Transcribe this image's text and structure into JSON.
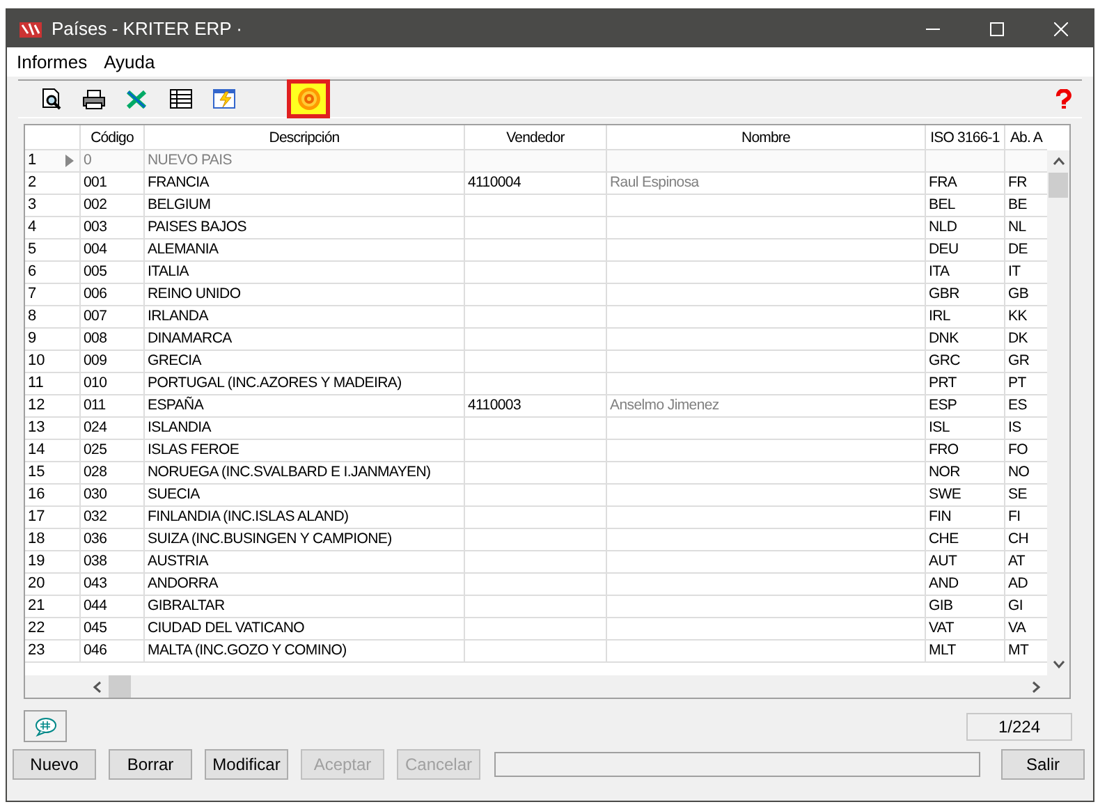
{
  "window": {
    "title": "Países - KRITER ERP ·"
  },
  "menu": [
    "Informes",
    "Ayuda"
  ],
  "toolbar": [
    {
      "kind": "preview",
      "selected": false
    },
    {
      "kind": "print",
      "selected": false
    },
    {
      "kind": "excel",
      "selected": false
    },
    {
      "kind": "grid",
      "selected": false
    },
    {
      "kind": "grid-edit",
      "selected": false
    },
    {
      "kind": "target",
      "selected": true
    }
  ],
  "table": {
    "columns": [
      "",
      "Código",
      "Descripción",
      "Vendedor",
      "Nombre",
      "ISO 3166-1",
      "Ab. A"
    ],
    "rows": [
      {
        "current": true,
        "cells": [
          "1",
          "0",
          "NUEVO PAIS",
          "",
          "",
          "",
          ""
        ]
      },
      {
        "current": false,
        "cells": [
          "2",
          "001",
          "FRANCIA",
          "4110004",
          "Raul Espinosa",
          "FRA",
          "FR"
        ]
      },
      {
        "current": false,
        "cells": [
          "3",
          "002",
          "BELGIUM",
          "",
          "",
          "BEL",
          "BE"
        ]
      },
      {
        "current": false,
        "cells": [
          "4",
          "003",
          "PAISES BAJOS",
          "",
          "",
          "NLD",
          "NL"
        ]
      },
      {
        "current": false,
        "cells": [
          "5",
          "004",
          "ALEMANIA",
          "",
          "",
          "DEU",
          "DE"
        ]
      },
      {
        "current": false,
        "cells": [
          "6",
          "005",
          "ITALIA",
          "",
          "",
          "ITA",
          "IT"
        ]
      },
      {
        "current": false,
        "cells": [
          "7",
          "006",
          "REINO UNIDO",
          "",
          "",
          "GBR",
          "GB"
        ]
      },
      {
        "current": false,
        "cells": [
          "8",
          "007",
          "IRLANDA",
          "",
          "",
          "IRL",
          "KK"
        ]
      },
      {
        "current": false,
        "cells": [
          "9",
          "008",
          "DINAMARCA",
          "",
          "",
          "DNK",
          "DK"
        ]
      },
      {
        "current": false,
        "cells": [
          "10",
          "009",
          "GRECIA",
          "",
          "",
          "GRC",
          "GR"
        ]
      },
      {
        "current": false,
        "cells": [
          "11",
          "010",
          "PORTUGAL (INC.AZORES Y MADEIRA)",
          "",
          "",
          "PRT",
          "PT"
        ]
      },
      {
        "current": false,
        "cells": [
          "12",
          "011",
          "ESPAÑA",
          "4110003",
          "Anselmo Jimenez",
          "ESP",
          "ES"
        ]
      },
      {
        "current": false,
        "cells": [
          "13",
          "024",
          "ISLANDIA",
          "",
          "",
          "ISL",
          "IS"
        ]
      },
      {
        "current": false,
        "cells": [
          "14",
          "025",
          "ISLAS FEROE",
          "",
          "",
          "FRO",
          "FO"
        ]
      },
      {
        "current": false,
        "cells": [
          "15",
          "028",
          "NORUEGA (INC.SVALBARD E I.JANMAYEN)",
          "",
          "",
          "NOR",
          "NO"
        ]
      },
      {
        "current": false,
        "cells": [
          "16",
          "030",
          "SUECIA",
          "",
          "",
          "SWE",
          "SE"
        ]
      },
      {
        "current": false,
        "cells": [
          "17",
          "032",
          "FINLANDIA (INC.ISLAS ALAND)",
          "",
          "",
          "FIN",
          "FI"
        ]
      },
      {
        "current": false,
        "cells": [
          "18",
          "036",
          "SUIZA (INC.BUSINGEN Y CAMPIONE)",
          "",
          "",
          "CHE",
          "CH"
        ]
      },
      {
        "current": false,
        "cells": [
          "19",
          "038",
          "AUSTRIA",
          "",
          "",
          "AUT",
          "AT"
        ]
      },
      {
        "current": false,
        "cells": [
          "20",
          "043",
          "ANDORRA",
          "",
          "",
          "AND",
          "AD"
        ]
      },
      {
        "current": false,
        "cells": [
          "21",
          "044",
          "GIBRALTAR",
          "",
          "",
          "GIB",
          "GI"
        ]
      },
      {
        "current": false,
        "cells": [
          "22",
          "045",
          "CIUDAD DEL VATICANO",
          "",
          "",
          "VAT",
          "VA"
        ]
      },
      {
        "current": false,
        "cells": [
          "23",
          "046",
          "MALTA (INC.GOZO Y COMINO)",
          "",
          "",
          "MLT",
          "MT"
        ]
      }
    ]
  },
  "record_counter": "1/224",
  "buttons": [
    {
      "label": "Nuevo",
      "disabled": false
    },
    {
      "label": "Borrar",
      "disabled": false
    },
    {
      "label": "Modificar",
      "disabled": false
    },
    {
      "label": "Aceptar",
      "disabled": true
    },
    {
      "label": "Cancelar",
      "disabled": true
    }
  ],
  "exit_button": {
    "label": "Salir",
    "disabled": false
  }
}
